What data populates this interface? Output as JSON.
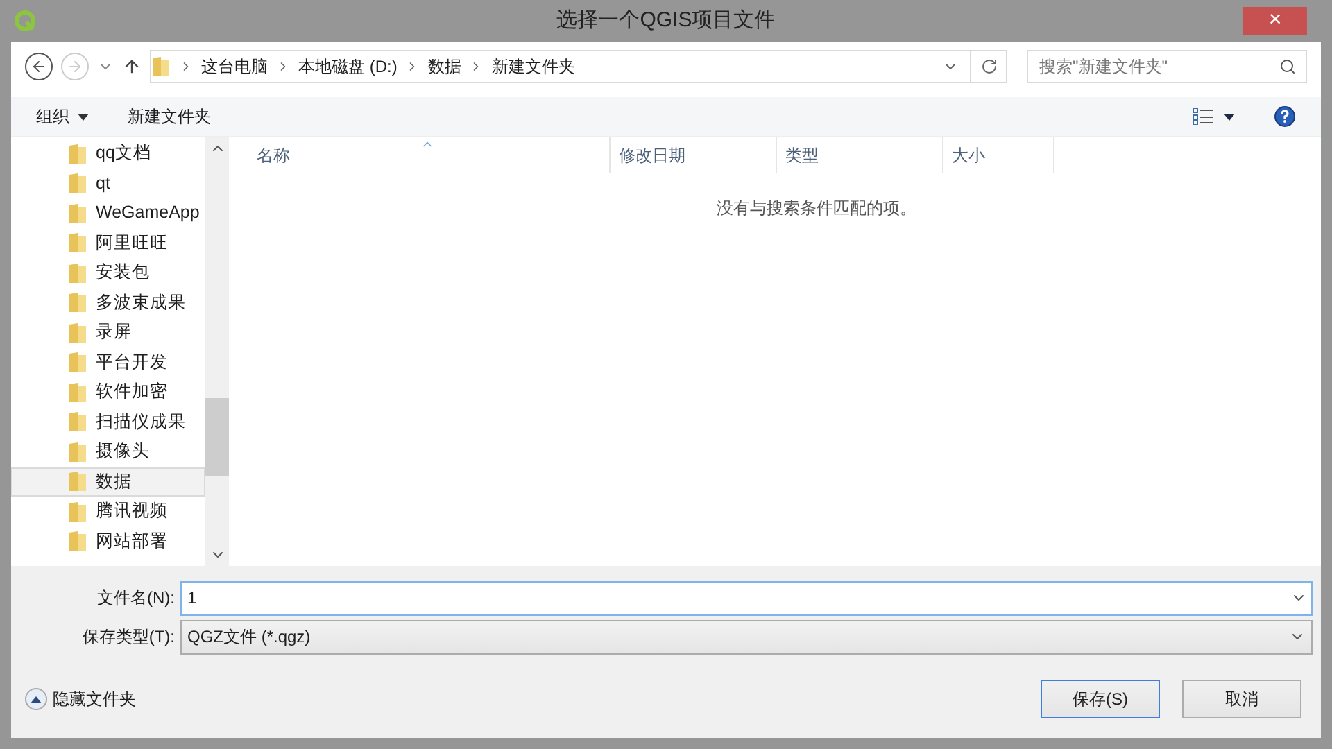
{
  "window": {
    "title": "选择一个QGIS项目文件",
    "close": "×"
  },
  "address_bar": {
    "crumbs": [
      "这台电脑",
      "本地磁盘 (D:)",
      "数据",
      "新建文件夹"
    ]
  },
  "search": {
    "placeholder": "搜索\"新建文件夹\""
  },
  "toolbar": {
    "organize": "组织",
    "new_folder": "新建文件夹"
  },
  "sidebar": {
    "items": [
      {
        "label": "qq文档",
        "selected": false
      },
      {
        "label": "qt",
        "selected": false
      },
      {
        "label": "WeGameApp",
        "selected": false
      },
      {
        "label": "阿里旺旺",
        "selected": false
      },
      {
        "label": "安装包",
        "selected": false
      },
      {
        "label": "多波束成果",
        "selected": false
      },
      {
        "label": "录屏",
        "selected": false
      },
      {
        "label": "平台开发",
        "selected": false
      },
      {
        "label": "软件加密",
        "selected": false
      },
      {
        "label": "扫描仪成果",
        "selected": false
      },
      {
        "label": "摄像头",
        "selected": false
      },
      {
        "label": "数据",
        "selected": true
      },
      {
        "label": "腾讯视频",
        "selected": false
      },
      {
        "label": "网站部署",
        "selected": false
      }
    ]
  },
  "table": {
    "columns": [
      "名称",
      "修改日期",
      "类型",
      "大小"
    ],
    "empty_message": "没有与搜索条件匹配的项。"
  },
  "form": {
    "file_name_label": "文件名(N):",
    "file_name": "1",
    "file_type_label": "保存类型(T):",
    "file_type": "QGZ文件 (*.qgz)"
  },
  "hide_folders": "隐藏文件夹",
  "buttons": [
    {
      "label": "保存(S)",
      "default": true
    },
    {
      "label": "取消",
      "default": false
    }
  ]
}
